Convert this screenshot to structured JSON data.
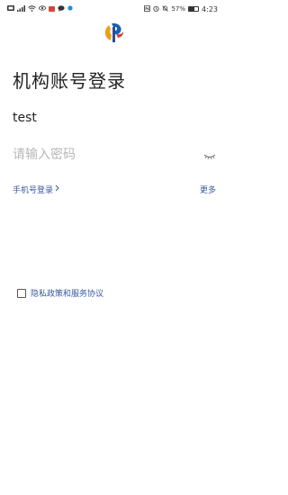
{
  "status_bar": {
    "battery_percent": "57%",
    "time": "4:23",
    "battery_level": 0.57
  },
  "login": {
    "title": "机构账号登录",
    "account_value": "test",
    "password_placeholder": "请输入密码",
    "phone_login_label": "手机号登录",
    "more_label": "更多",
    "agreement_label": "隐私政策和服务协议"
  },
  "colors": {
    "accent": "#3a58a0",
    "title": "#222222",
    "placeholder": "#b7b7b7"
  }
}
